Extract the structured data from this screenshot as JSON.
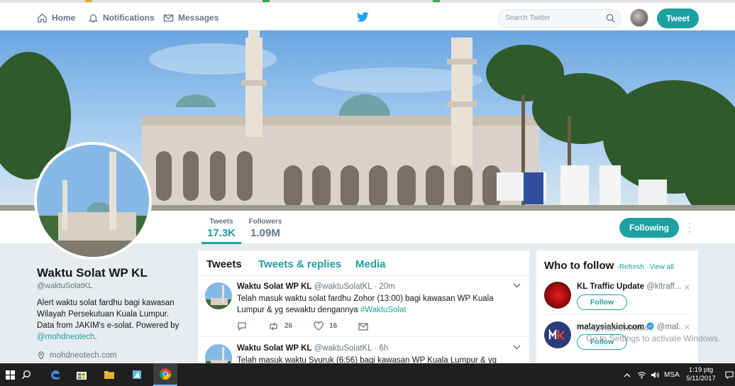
{
  "nav": {
    "home_label": "Home",
    "notifications_label": "Notifications",
    "messages_label": "Messages",
    "search_placeholder": "Search Twitter",
    "tweet_button": "Tweet"
  },
  "profile": {
    "name": "Waktu Solat WP KL",
    "handle": "@waktuSolatKL",
    "bio": "Alert waktu solat fardhu bagi kawasan Wilayah Persekutuan Kuala Lumpur. Data from JAKIM's e-solat. Powered by ",
    "bio_link": "@mohdneotech",
    "bio_end": ".",
    "location": "mohdneotech.com"
  },
  "stats": {
    "tweets_label": "Tweets",
    "tweets_value": "17.3K",
    "followers_label": "Followers",
    "followers_value": "1.09M",
    "following_button": "Following"
  },
  "timeline": {
    "tabs": [
      "Tweets",
      "Tweets & replies",
      "Media"
    ],
    "tweets": [
      {
        "name": "Waktu Solat WP KL",
        "handle": "@waktuSolatKL",
        "time": "· 20m",
        "text": "Telah masuk waktu solat fardhu Zohor (13:00) bagi kawasan WP Kuala Lumpur & yg sewaktu dengannya ",
        "hashtag": "#WaktuSolat",
        "retweets": "26",
        "likes": "16"
      },
      {
        "name": "Waktu Solat WP KL",
        "handle": "@waktuSolatKL",
        "time": "· 6h",
        "text": "Telah masuk waktu Syuruk (6:56) bagi kawasan WP Kuala Lumpur & yg"
      }
    ]
  },
  "who_to_follow": {
    "title": "Who to follow",
    "refresh": "Refresh",
    "view_all": "View all",
    "separator": "·",
    "suggestions": [
      {
        "name": "KL Traffic Update",
        "handle": "@kltraff...",
        "button": "Follow"
      },
      {
        "name": "malaysiakini.com",
        "handle": "@mal...",
        "button": "Follow",
        "verified": true
      }
    ]
  },
  "watermark": {
    "line1": "Activate Windows",
    "line2": "Go to Settings to activate Windows."
  },
  "taskbar": {
    "lang": "MSA",
    "time": "1:19 ptg",
    "date": "5/11/2017"
  },
  "colors": {
    "accent": "#1da1a0",
    "twitter_blue": "#1da1f2",
    "background": "#e6ecf0"
  }
}
